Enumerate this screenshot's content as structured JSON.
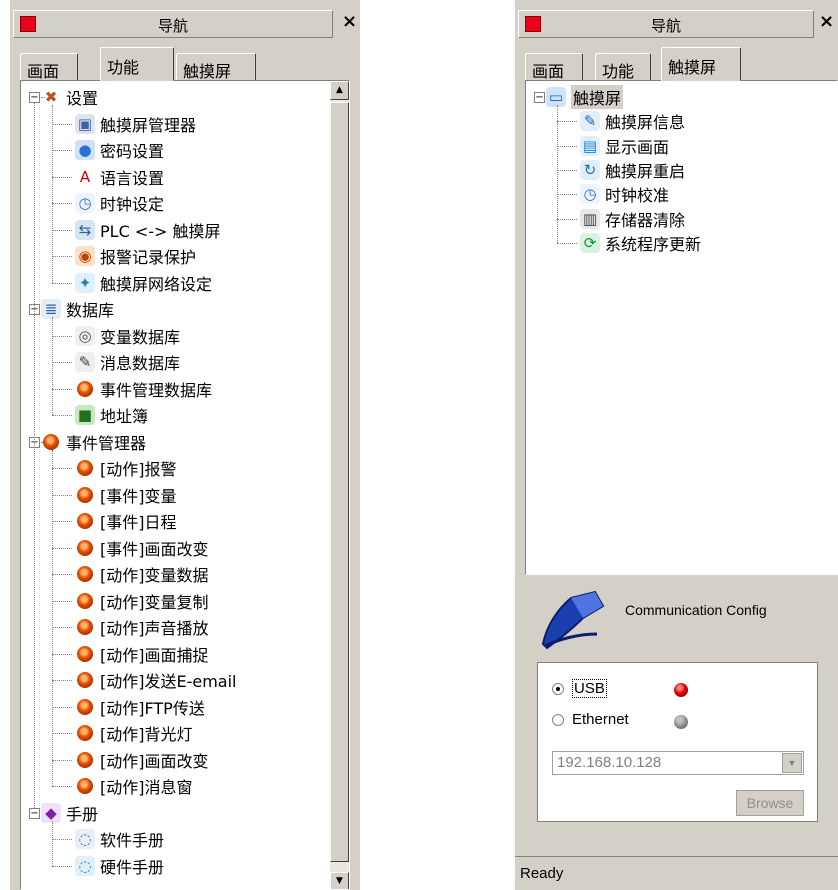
{
  "left_panel": {
    "title": "导航",
    "close": "×",
    "tabs": [
      "画面",
      "功能",
      "触摸屏"
    ],
    "active_tab": 1,
    "tree": [
      {
        "label": "设置",
        "icon": "tools-icon",
        "group": true,
        "expanded": true,
        "pm": "−"
      },
      {
        "label": "触摸屏管理器",
        "icon": "hmi-manager-icon"
      },
      {
        "label": "密码设置",
        "icon": "password-icon"
      },
      {
        "label": "语言设置",
        "icon": "language-icon"
      },
      {
        "label": "时钟设定",
        "icon": "clock-icon"
      },
      {
        "label": "PLC <-> 触摸屏",
        "icon": "plc-link-icon"
      },
      {
        "label": "报警记录保护",
        "icon": "alarm-protect-icon"
      },
      {
        "label": "触摸屏网络设定",
        "icon": "network-icon"
      },
      {
        "label": "数据库",
        "icon": "database-icon",
        "group": true,
        "expanded": true,
        "pm": "−"
      },
      {
        "label": "变量数据库",
        "icon": "variable-db-icon"
      },
      {
        "label": "消息数据库",
        "icon": "message-db-icon"
      },
      {
        "label": "事件管理数据库",
        "icon": "event-icon"
      },
      {
        "label": "地址簿",
        "icon": "address-book-icon"
      },
      {
        "label": "事件管理器",
        "icon": "event-icon",
        "group": true,
        "expanded": true,
        "pm": "−"
      },
      {
        "label": "[动作]报警",
        "icon": "event-icon"
      },
      {
        "label": "[事件]变量",
        "icon": "event-icon"
      },
      {
        "label": "[事件]日程",
        "icon": "event-icon"
      },
      {
        "label": "[事件]画面改变",
        "icon": "event-icon"
      },
      {
        "label": "[动作]变量数据",
        "icon": "event-icon"
      },
      {
        "label": "[动作]变量复制",
        "icon": "event-icon"
      },
      {
        "label": "[动作]声音播放",
        "icon": "event-icon"
      },
      {
        "label": "[动作]画面捕捉",
        "icon": "event-icon"
      },
      {
        "label": "[动作]发送E-email",
        "icon": "event-icon"
      },
      {
        "label": "[动作]FTP传送",
        "icon": "event-icon"
      },
      {
        "label": "[动作]背光灯",
        "icon": "event-icon"
      },
      {
        "label": "[动作]画面改变",
        "icon": "event-icon"
      },
      {
        "label": "[动作]消息窗",
        "icon": "event-icon"
      },
      {
        "label": "手册",
        "icon": "manual-icon",
        "group": true,
        "expanded": true,
        "pm": "−"
      },
      {
        "label": "软件手册",
        "icon": "software-manual-icon"
      },
      {
        "label": "硬件手册",
        "icon": "hardware-manual-icon"
      }
    ],
    "scroll_up": "▲",
    "scroll_down": "▼"
  },
  "right_panel": {
    "title": "导航",
    "close": "×",
    "tabs": [
      "画面",
      "功能",
      "触摸屏"
    ],
    "active_tab": 2,
    "tree": [
      {
        "label": "触摸屏",
        "icon": "touchscreen-icon",
        "group": true,
        "expanded": true,
        "pm": "−",
        "selected": true
      },
      {
        "label": "触摸屏信息",
        "icon": "hmi-info-icon"
      },
      {
        "label": "显示画面",
        "icon": "display-screen-icon"
      },
      {
        "label": "触摸屏重启",
        "icon": "restart-icon"
      },
      {
        "label": "时钟校准",
        "icon": "clock-icon"
      },
      {
        "label": "存储器清除",
        "icon": "memory-clear-icon"
      },
      {
        "label": "系统程序更新",
        "icon": "update-icon"
      }
    ],
    "comm": {
      "title": "Communication Config",
      "usb_label": "USB",
      "ethernet_label": "Ethernet",
      "selected": "USB",
      "usb_status_color": "#e00000",
      "ethernet_status_color": "#808080",
      "ip_value": "192.168.10.128",
      "dropdown": "▼",
      "browse_label": "Browse"
    },
    "status": "Ready"
  }
}
